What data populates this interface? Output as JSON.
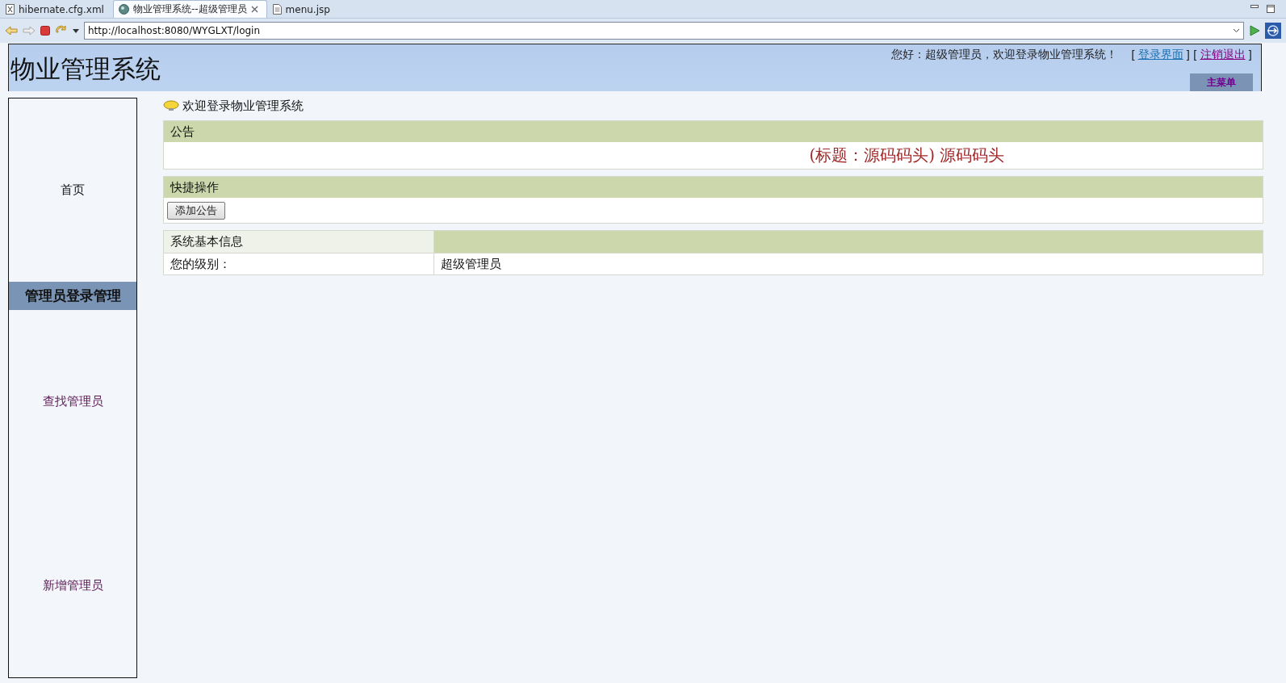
{
  "editor_tabs": [
    {
      "label": "hibernate.cfg.xml",
      "kind": "xml",
      "selected": false,
      "closable": false
    },
    {
      "label": "物业管理系统--超级管理员",
      "kind": "web",
      "selected": true,
      "closable": true
    },
    {
      "label": "menu.jsp",
      "kind": "file",
      "selected": false,
      "closable": false
    }
  ],
  "address_bar": {
    "url": "http://localhost:8080/WYGLXT/login"
  },
  "header": {
    "title": "物业管理系统",
    "greeting": "您好：超级管理员，欢迎登录物业管理系统！",
    "links": [
      {
        "open": "[",
        "label": "登录界面",
        "close": "]",
        "visited": false
      },
      {
        "open": "[",
        "label": "注销退出",
        "close": "]",
        "visited": true
      }
    ],
    "menu_button": "主菜单"
  },
  "sidebar": {
    "items": [
      {
        "kind": "link",
        "label": "首页",
        "visited": false
      },
      {
        "kind": "heading",
        "label": "管理员登录管理"
      },
      {
        "kind": "link",
        "label": "查找管理员",
        "visited": true
      },
      {
        "kind": "link",
        "label": "新增管理员",
        "visited": true
      }
    ]
  },
  "content": {
    "welcome": "欢迎登录物业管理系统",
    "notice": {
      "heading": "公告",
      "text": "(标题：源码码头) 源码码头"
    },
    "quick_actions": {
      "heading": "快捷操作",
      "buttons": [
        "添加公告"
      ]
    },
    "info_table": {
      "heading": "系统基本信息",
      "rows": [
        {
          "label": "您的级别：",
          "value": "超级管理员"
        }
      ]
    }
  }
}
